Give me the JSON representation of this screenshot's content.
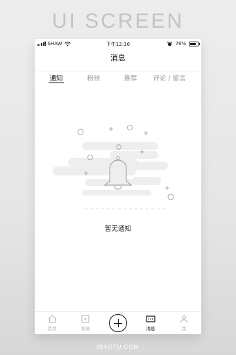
{
  "banner": "UI SCREEN",
  "status_bar": {
    "carrier": "SHAW",
    "time": "下午12:16",
    "battery": "78%",
    "battery_level": 0.78
  },
  "header": {
    "title": "消息"
  },
  "tabs": [
    {
      "label": "通知",
      "active": true
    },
    {
      "label": "粉丝",
      "active": false
    },
    {
      "label": "推荐",
      "active": false
    },
    {
      "label": "评论 / 留言",
      "active": false
    }
  ],
  "empty_state": {
    "icon": "bell-icon",
    "text": "暂无通知"
  },
  "tab_bar": {
    "items": [
      {
        "label": "首页",
        "icon": "home-icon",
        "active": false
      },
      {
        "label": "发现",
        "icon": "discover-icon",
        "active": false
      },
      {
        "label": "",
        "icon": "plus-icon",
        "active": false
      },
      {
        "label": "消息",
        "icon": "message-icon",
        "active": true
      },
      {
        "label": "我",
        "icon": "user-icon",
        "active": false
      }
    ]
  },
  "watermark": "IBAOTU.COM",
  "colors": {
    "active_text": "#111111",
    "inactive_text": "#9a9a9a",
    "illustration": "#eeeeee"
  }
}
